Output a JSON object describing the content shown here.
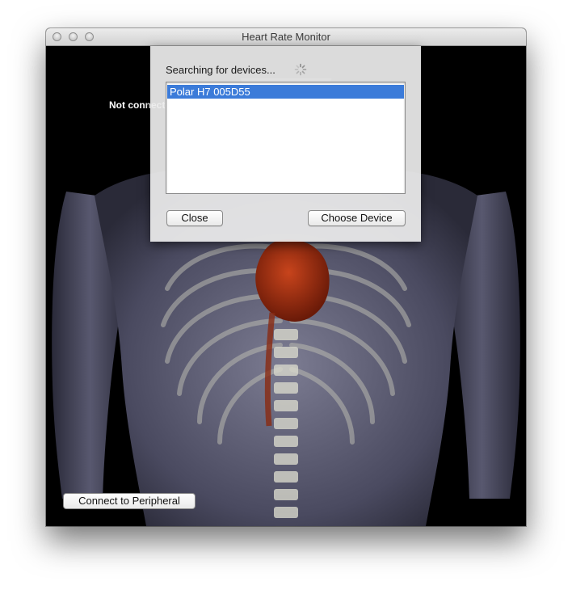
{
  "window": {
    "title": "Heart Rate Monitor"
  },
  "main": {
    "status_text": "Not connected",
    "connect_button_label": "Connect to Peripheral"
  },
  "sheet": {
    "searching_text": "Searching for devices...",
    "devices": [
      "Polar H7 005D55"
    ],
    "selected_index": 0,
    "close_label": "Close",
    "choose_label": "Choose Device"
  },
  "colors": {
    "selection": "#3b7bd9",
    "window_background": "#000000",
    "heart": "#9a2a12"
  },
  "icons": {
    "spinner": "progress-spinner-icon",
    "traffic_lights": [
      "close-window-icon",
      "minimize-window-icon",
      "zoom-window-icon"
    ]
  }
}
